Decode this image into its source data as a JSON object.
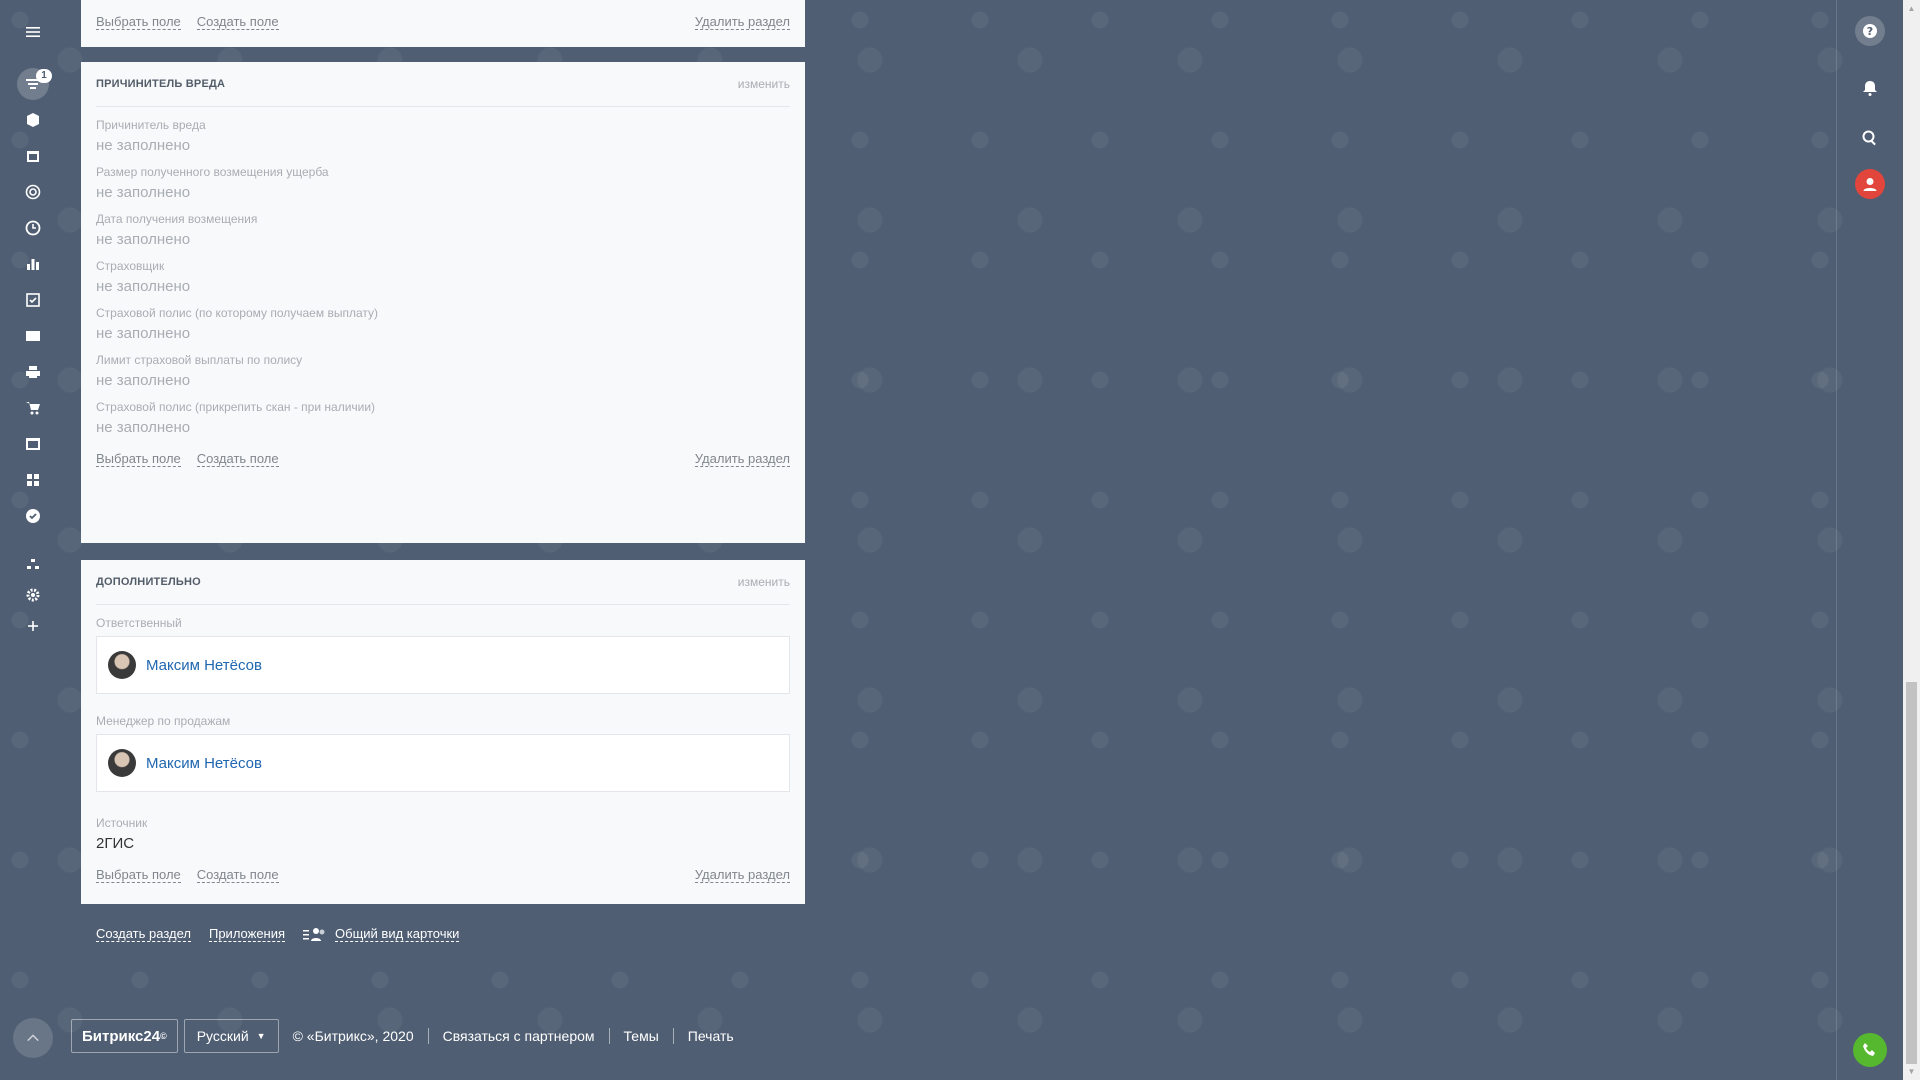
{
  "sidebar": {
    "badge_count": "1",
    "icons": [
      "menu-icon",
      "filter-icon",
      "box-icon",
      "calendar-icon",
      "target-icon",
      "clock-icon",
      "chart-icon",
      "checkbox-icon",
      "mail-icon",
      "printer-icon",
      "cart-icon",
      "window-icon",
      "grid-icon",
      "check-circle-icon",
      "sitemap-icon",
      "gear-icon",
      "plus-icon"
    ]
  },
  "top_section": {
    "select_field": "Выбрать поле",
    "create_field": "Создать поле",
    "delete_section": "Удалить раздел"
  },
  "harm_section": {
    "title": "ПРИЧИНИТЕЛЬ ВРЕДА",
    "edit": "изменить",
    "fields": [
      {
        "label": "Причинитель вреда",
        "value": "не заполнено"
      },
      {
        "label": "Размер полученного возмещения ущерба",
        "value": "не заполнено"
      },
      {
        "label": "Дата получения возмещения",
        "value": "не заполнено"
      },
      {
        "label": "Страховщик",
        "value": "не заполнено"
      },
      {
        "label": "Страховой полис (по которому получаем выплату)",
        "value": "не заполнено"
      },
      {
        "label": "Лимит страховой выплаты по полису",
        "value": "не заполнено"
      },
      {
        "label": "Страховой полис (прикрепить скан - при наличии)",
        "value": "не заполнено"
      }
    ],
    "select_field": "Выбрать поле",
    "create_field": "Создать поле",
    "delete_section": "Удалить раздел"
  },
  "extra_section": {
    "title": "ДОПОЛНИТЕЛЬНО",
    "edit": "изменить",
    "responsible_label": "Ответственный",
    "responsible_name": "Максим Нетёсов",
    "manager_label": "Менеджер по продажам",
    "manager_name": "Максим Нетёсов",
    "source_label": "Источник",
    "source_value": "2ГИС",
    "select_field": "Выбрать поле",
    "create_field": "Создать поле",
    "delete_section": "Удалить раздел"
  },
  "bottom_links": {
    "create_section": "Создать раздел",
    "apps": "Приложения",
    "general_view": "Общий вид карточки"
  },
  "footer": {
    "logo": "Битрикс24",
    "logo_mark": "©",
    "language": "Русский",
    "copyright": "© «Битрикс», 2020",
    "contact_partner": "Связаться с партнером",
    "themes": "Темы",
    "print": "Печать"
  },
  "colors": {
    "background": "#4f5e72",
    "card": "#f8f9fa",
    "link_blue": "#2067b0",
    "avatar_red": "#e2453c",
    "phone_green": "#2fc6f6"
  }
}
